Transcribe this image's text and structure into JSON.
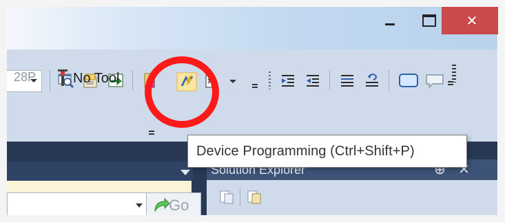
{
  "window": {
    "minimize_label": "–",
    "maximize_label": "□",
    "close_label": "✕",
    "close_color": "#c94a4a"
  },
  "toolbar": {
    "items": [
      {
        "name": "find-icon"
      },
      {
        "name": "properties-icon"
      },
      {
        "name": "import-icon"
      },
      {
        "name": "gradient-icon"
      },
      {
        "name": "device-programming-icon"
      },
      {
        "name": "terminal-icon"
      }
    ],
    "right_items": [
      {
        "name": "indent-icon"
      },
      {
        "name": "outdent-icon"
      },
      {
        "name": "align-icon"
      },
      {
        "name": "format-icon"
      },
      {
        "name": "window-icon"
      },
      {
        "name": "comment-icon"
      }
    ],
    "ghost_text": "28P",
    "tool_label": "No Tool"
  },
  "highlight": {
    "color": "#ff1a1a",
    "target": "device-programming-icon"
  },
  "tooltip": {
    "text": "Device Programming (Ctrl+Shift+P)"
  },
  "left_panel": {
    "go_label": "Go"
  },
  "solution_explorer": {
    "title": "Solution Explorer",
    "pin_label": "⊕",
    "close_label": "✕"
  }
}
